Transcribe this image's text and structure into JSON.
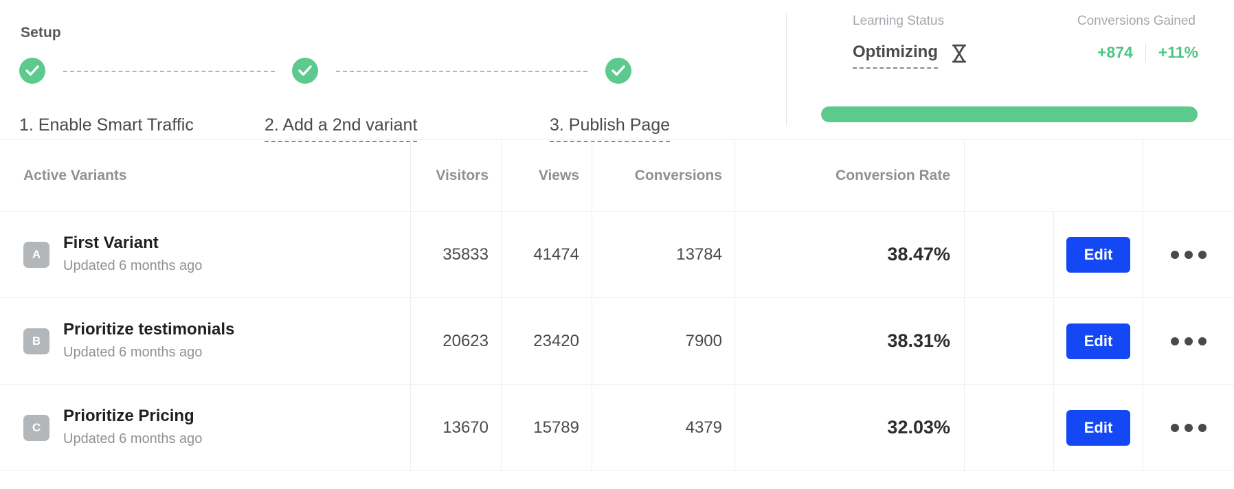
{
  "setup": {
    "title": "Setup",
    "steps": [
      {
        "label": "1. Enable Smart Traffic",
        "complete": true,
        "dashed_underline": false
      },
      {
        "label": "2. Add a 2nd variant",
        "complete": true,
        "dashed_underline": true
      },
      {
        "label": "3. Publish Page",
        "complete": true,
        "dashed_underline": true
      }
    ],
    "check_icon": "check-icon",
    "accent_green": "#5cc98d"
  },
  "status": {
    "learning_status_label": "Learning Status",
    "learning_status_value": "Optimizing",
    "status_icon": "hourglass-icon",
    "conversions_gained_label": "Conversions Gained",
    "conversions_gained_value": "+874",
    "conversions_gained_percent": "+11%",
    "progress_percent": 100,
    "progress_color": "#5cc98d",
    "gain_color": "#4fc585"
  },
  "table": {
    "columns": [
      "Active Variants",
      "Visitors",
      "Views",
      "Conversions",
      "Conversion Rate"
    ],
    "rows": [
      {
        "badge": "A",
        "title": "First Variant",
        "subtitle": "Updated 6 months ago",
        "visitors": "35833",
        "views": "41474",
        "conversions": "13784",
        "conversion_rate": "38.47%",
        "edit_label": "Edit",
        "more_icon": "ellipsis-icon"
      },
      {
        "badge": "B",
        "title": "Prioritize testimonials",
        "subtitle": "Updated 6 months ago",
        "visitors": "20623",
        "views": "23420",
        "conversions": "7900",
        "conversion_rate": "38.31%",
        "edit_label": "Edit",
        "more_icon": "ellipsis-icon"
      },
      {
        "badge": "C",
        "title": "Prioritize Pricing",
        "subtitle": "Updated 6 months ago",
        "visitors": "13670",
        "views": "15789",
        "conversions": "4379",
        "conversion_rate": "32.03%",
        "edit_label": "Edit",
        "more_icon": "ellipsis-icon"
      }
    ],
    "edit_button_color": "#1448f5"
  }
}
